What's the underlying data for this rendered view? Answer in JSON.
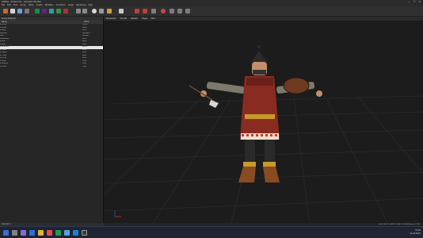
{
  "window": {
    "title": "3dsMax - Soldier.max - Autodesk 3ds Max",
    "controls": {
      "minimize": "—",
      "maximize": "☐",
      "close": "✕"
    }
  },
  "menu": [
    "File",
    "Edit",
    "Tools",
    "Group",
    "Views",
    "Create",
    "Modifiers",
    "Animation",
    "Graph",
    "Rendering",
    "Help"
  ],
  "toolbar": {
    "icons": [
      "select-icon",
      "move-icon",
      "rotate-icon",
      "scale-icon",
      "link-icon",
      "material-icon",
      "render-icon",
      "light-icon",
      "camera-icon"
    ]
  },
  "left_panel": {
    "title": "Scene Explorer",
    "columns": [
      "Name",
      "Value"
    ],
    "rows": [
      {
        "name": "▾ Scene",
        "value": "Scene"
      },
      {
        "name": "  ▾ Soldier",
        "value": "Node"
      },
      {
        "name": "    ▾ Body",
        "value": "Mesh"
      },
      {
        "name": "      Material",
        "value": "Standard"
      },
      {
        "name": "      Skin",
        "value": "Modifier"
      },
      {
        "name": "    ▾ Armature",
        "value": "Bone"
      },
      {
        "name": "      ▸ Root",
        "value": "Bone"
      },
      {
        "name": "      ▸ Spine",
        "value": "Bone"
      },
      {
        "name": "      ▸ Selected",
        "value": "Active"
      },
      {
        "name": "        ▸ L_Arm",
        "value": "Bone"
      },
      {
        "name": "        ▸ R_Arm",
        "value": "Bone"
      },
      {
        "name": "        ▸ L_Leg",
        "value": "Bone"
      },
      {
        "name": "        ▸ R_Leg",
        "value": "Bone"
      },
      {
        "name": "        ▸ Head",
        "value": "Bone"
      },
      {
        "name": "        ▸ Weapon",
        "value": "Prop"
      },
      {
        "name": "        ▸ Shield",
        "value": "Prop"
      }
    ],
    "selected_index": 8,
    "footer": "Selected: 1"
  },
  "viewport": {
    "tabs": [
      "Perspective",
      "Smooth",
      "Realistic",
      "Edges",
      "Wire"
    ],
    "status": "Grid: 10.0   X: 0.000  Y: 0.000  Z: 0.000   Frame: 0 / 100"
  },
  "taskbar": {
    "time": "15:42",
    "date": "12.03.2022"
  },
  "colors": {
    "accent": "#e6e6e6",
    "grid": "#333333",
    "tunic": "#8a2b22",
    "sleeves": "#8a8a7a"
  }
}
